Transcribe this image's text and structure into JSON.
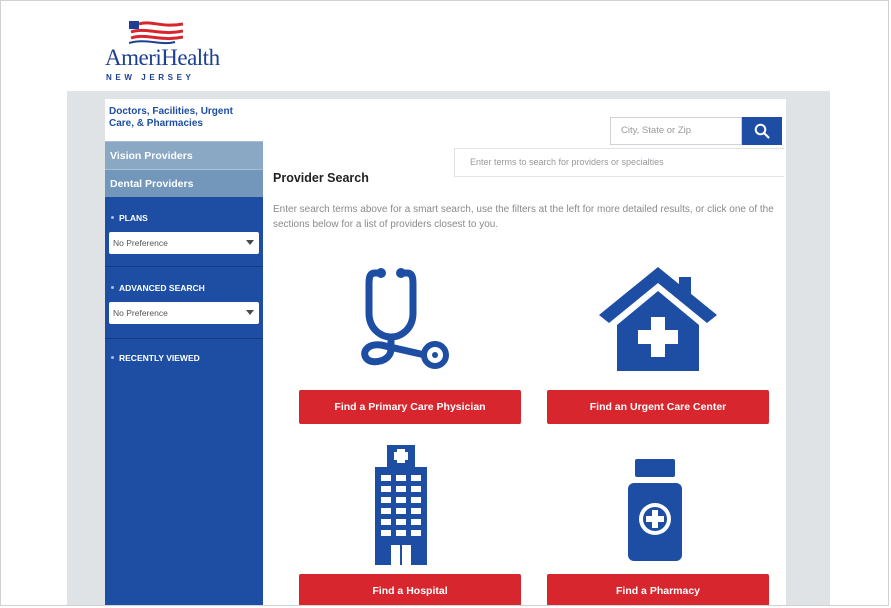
{
  "brand": {
    "name": "AmeriHealth",
    "region": "NEW JERSEY"
  },
  "sidebar": {
    "active_item": "Doctors, Facilities, Urgent Care, & Pharmacies",
    "tabs": [
      "Vision Providers",
      "Dental Providers"
    ],
    "plans": {
      "label": "PLANS",
      "selected": "No Preference"
    },
    "advanced": {
      "label": "ADVANCED SEARCH",
      "selected": "No Preference"
    },
    "recent": {
      "label": "RECENTLY VIEWED"
    }
  },
  "search": {
    "location_placeholder": "City, State or Zip",
    "terms_placeholder": "Enter terms to search for providers or specialties",
    "icon": "search-icon"
  },
  "main": {
    "title": "Provider Search",
    "intro": "Enter search terms above for a smart search, use the filters at the left for more detailed results, or click one of the sections below for a list of providers closest to you.",
    "cards": [
      {
        "label": "Find a Primary Care Physician",
        "icon": "stethoscope-icon"
      },
      {
        "label": "Find an Urgent Care Center",
        "icon": "house-medical-icon"
      },
      {
        "label": "Find a Hospital",
        "icon": "hospital-building-icon"
      },
      {
        "label": "Find a Pharmacy",
        "icon": "medicine-bottle-icon"
      }
    ]
  },
  "colors": {
    "primary": "#1d4ea3",
    "accent": "#d8262f",
    "tab": "#8aa7c4",
    "band": "#dfe3e6"
  }
}
